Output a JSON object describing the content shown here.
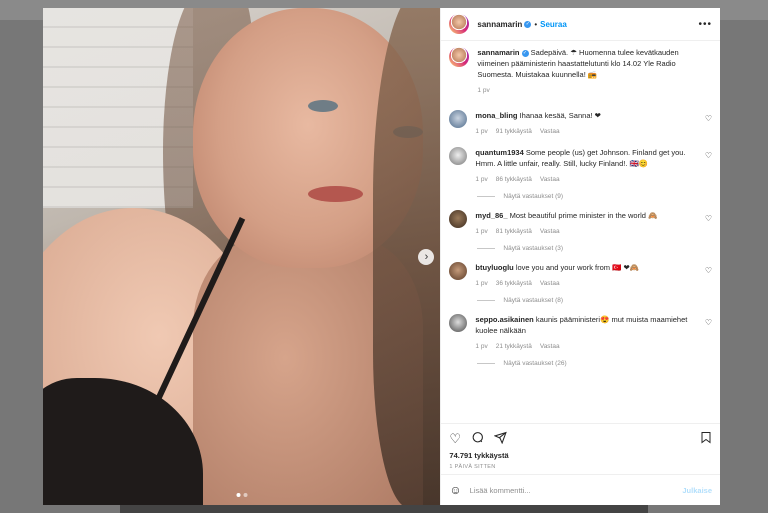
{
  "post": {
    "author": "sannamarin",
    "follow_label": "Seuraa",
    "caption": "Sadepäivä. ☂ Huomenna tulee kevätkauden viimeinen pääministerin haastattelutunti klo 14.02 Yle Radio Suomesta. Muistakaa kuunnella! 📻",
    "caption_time": "1 pv",
    "likes": "74.791 tykkäystä",
    "time_ago": "1 PÄIVÄ SITTEN",
    "add_comment_placeholder": "Lisää kommentti...",
    "post_button": "Julkaise"
  },
  "comments": [
    {
      "user": "mona_bling",
      "text": "Ihanaa kesää, Sanna! ❤",
      "time": "1 pv",
      "likes": "91 tykkäystä",
      "reply": "Vastaa",
      "replies": ""
    },
    {
      "user": "quantum1934",
      "text": "Some people (us) get Johnson. Finland get you. Hmm. A little unfair, really. Still, lucky Finland!. 🇬🇧😊",
      "time": "1 pv",
      "likes": "86 tykkäystä",
      "reply": "Vastaa",
      "replies": "Näytä vastaukset (9)"
    },
    {
      "user": "myd_86_",
      "text": "Most beautiful prime minister in the world 🙈",
      "time": "1 pv",
      "likes": "81 tykkäystä",
      "reply": "Vastaa",
      "replies": "Näytä vastaukset (3)"
    },
    {
      "user": "btuyluoglu",
      "text": "love you and your work from 🇹🇷 ❤🙈",
      "time": "1 pv",
      "likes": "36 tykkäystä",
      "reply": "Vastaa",
      "replies": "Näytä vastaukset (8)"
    },
    {
      "user": "seppo.asikainen",
      "text": "kaunis pääministeri😍 mut muista maamiehet kuolee nälkään",
      "time": "1 pv",
      "likes": "21 tykkäystä",
      "reply": "Vastaa",
      "replies": "Näytä vastaukset (26)"
    }
  ],
  "icons": {
    "more": "more-options-icon",
    "like": "heart-icon",
    "comment": "comment-icon",
    "share": "paper-plane-icon",
    "save": "bookmark-icon",
    "emoji": "emoji-icon",
    "next": "chevron-right-icon"
  },
  "colors": {
    "accent": "#0095f6",
    "heart": "#ed4956",
    "verified": "#3897f0"
  }
}
